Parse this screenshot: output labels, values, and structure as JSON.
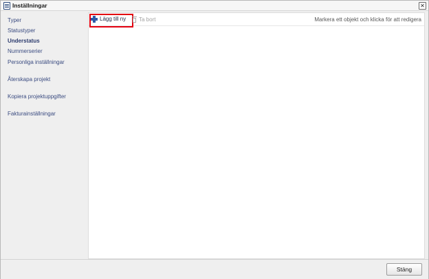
{
  "window": {
    "title": "Inställningar",
    "close_symbol": "✕"
  },
  "sidebar": {
    "items": [
      {
        "label": "Typer",
        "active": false
      },
      {
        "label": "Statustyper",
        "active": false
      },
      {
        "label": "Understatus",
        "active": true
      },
      {
        "label": "Nummerserier",
        "active": false
      },
      {
        "label": "Personliga inställningar",
        "active": false
      },
      {
        "label": "Återskapa projekt",
        "active": false
      },
      {
        "label": "Kopiera projektuppgifter",
        "active": false
      },
      {
        "label": "Fakturainställningar",
        "active": false
      }
    ]
  },
  "toolbar": {
    "add_label": "Lägg till ny",
    "delete_label": "Ta bort",
    "hint": "Markera ett objekt och klicka för att redigera",
    "add_icon": "plus-icon",
    "delete_icon": "trash-icon",
    "highlight_color": "#e3000f"
  },
  "footer": {
    "close_label": "Stäng"
  }
}
